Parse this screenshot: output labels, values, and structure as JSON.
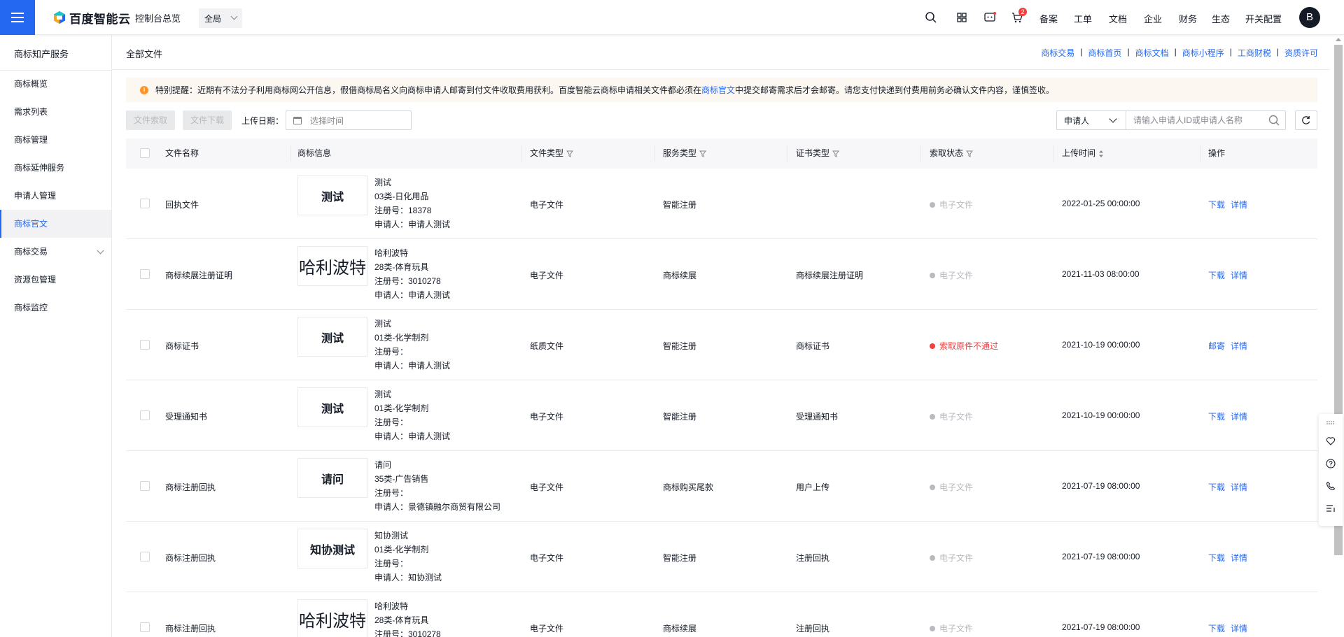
{
  "topbar": {
    "brand": "百度智能云",
    "console": "控制台总览",
    "region": "全局",
    "cart_badge": "2",
    "nav": [
      "备案",
      "工单",
      "文档",
      "企业",
      "财务",
      "生态",
      "开关配置"
    ],
    "avatar": "B",
    "icons": [
      "search-icon",
      "apps-icon",
      "message-icon",
      "cart-icon"
    ]
  },
  "sidebar": {
    "title": "商标知产服务",
    "items": [
      {
        "label": "商标概览"
      },
      {
        "label": "需求列表"
      },
      {
        "label": "商标管理"
      },
      {
        "label": "商标延伸服务"
      },
      {
        "label": "申请人管理"
      },
      {
        "label": "商标官文",
        "active": true
      },
      {
        "label": "商标交易",
        "expandable": true
      },
      {
        "label": "资源包管理"
      },
      {
        "label": "商标监控"
      }
    ]
  },
  "main": {
    "title": "全部文件",
    "quick_links": [
      "商标交易",
      "商标首页",
      "商标文档",
      "商标小程序",
      "工商财税",
      "资质许可"
    ],
    "notice": {
      "before": "特别提醒：近期有不法分子利用商标网公开信息，假借商标局名义向商标申请人邮寄到付文件收取费用获利。百度智能云商标申请相关文件都必须在",
      "link": "商标官文",
      "after": "中提交邮寄需求后才会邮寄。请您支付快递到付费用前务必确认文件内容，谨慎签收。"
    },
    "toolbar": {
      "retrieve_label": "文件索取",
      "download_label": "文件下载",
      "upload_date_label": "上传日期：",
      "date_placeholder": "选择时间",
      "search_type": "申请人",
      "search_placeholder": "请输入申请人ID或申请人名称"
    }
  },
  "table": {
    "columns": [
      "文件名称",
      "商标信息",
      "文件类型",
      "服务类型",
      "证书类型",
      "索取状态",
      "上传时间",
      "操作"
    ],
    "rows": [
      {
        "file_name": "回执文件",
        "tm_image": "测试",
        "tm_name": "测试",
        "tm_class": "03类-日化用品",
        "reg_no": "注册号：18378",
        "applicant": "申请人：申请人测试",
        "file_type": "电子文件",
        "service_type": "智能注册",
        "cert_type": "",
        "status": "电子文件",
        "status_error": false,
        "upload_time": "2022-01-25 00:00:00",
        "action1": "下载",
        "action2": "详情"
      },
      {
        "file_name": "商标续展注册证明",
        "tm_image": "哈利波特",
        "tm_name": "哈利波特",
        "tm_class": "28类-体育玩具",
        "reg_no": "注册号：3010278",
        "applicant": "申请人：申请人测试",
        "file_type": "电子文件",
        "service_type": "商标续展",
        "cert_type": "商标续展注册证明",
        "status": "电子文件",
        "status_error": false,
        "upload_time": "2021-11-03 08:00:00",
        "action1": "下载",
        "action2": "详情"
      },
      {
        "file_name": "商标证书",
        "tm_image": "测试",
        "tm_name": "测试",
        "tm_class": "01类-化学制剂",
        "reg_no": "注册号：",
        "applicant": "申请人：申请人测试",
        "file_type": "纸质文件",
        "service_type": "智能注册",
        "cert_type": "商标证书",
        "status": "索取原件不通过",
        "status_error": true,
        "upload_time": "2021-10-19 00:00:00",
        "action1": "邮寄",
        "action2": "详情"
      },
      {
        "file_name": "受理通知书",
        "tm_image": "测试",
        "tm_name": "测试",
        "tm_class": "01类-化学制剂",
        "reg_no": "注册号：",
        "applicant": "申请人：申请人测试",
        "file_type": "电子文件",
        "service_type": "智能注册",
        "cert_type": "受理通知书",
        "status": "电子文件",
        "status_error": false,
        "upload_time": "2021-10-19 00:00:00",
        "action1": "下载",
        "action2": "详情"
      },
      {
        "file_name": "商标注册回执",
        "tm_image": "请问",
        "tm_name": "请问",
        "tm_class": "35类-广告销售",
        "reg_no": "注册号：",
        "applicant": "申请人：景德镇融尔商贸有限公司",
        "file_type": "电子文件",
        "service_type": "商标购买尾款",
        "cert_type": "用户上传",
        "status": "电子文件",
        "status_error": false,
        "upload_time": "2021-07-19 08:00:00",
        "action1": "下载",
        "action2": "详情"
      },
      {
        "file_name": "商标注册回执",
        "tm_image": "知协测试",
        "tm_name": "知协测试",
        "tm_class": "01类-化学制剂",
        "reg_no": "注册号：",
        "applicant": "申请人：知协测试",
        "file_type": "电子文件",
        "service_type": "智能注册",
        "cert_type": "注册回执",
        "status": "电子文件",
        "status_error": false,
        "upload_time": "2021-07-19 08:00:00",
        "action1": "下载",
        "action2": "详情"
      },
      {
        "file_name": "商标注册回执",
        "tm_image": "哈利波特",
        "tm_name": "哈利波特",
        "tm_class": "28类-体育玩具",
        "reg_no": "注册号：3010278",
        "applicant": "",
        "file_type": "电子文件",
        "service_type": "商标续展",
        "cert_type": "注册回执",
        "status": "电子文件",
        "status_error": false,
        "upload_time": "2021-07-19 08:00:00",
        "action1": "下载",
        "action2": "详情"
      }
    ]
  },
  "colors": {
    "primary": "#2468f2",
    "error": "#f33e3e",
    "warning": "#ff9326"
  }
}
